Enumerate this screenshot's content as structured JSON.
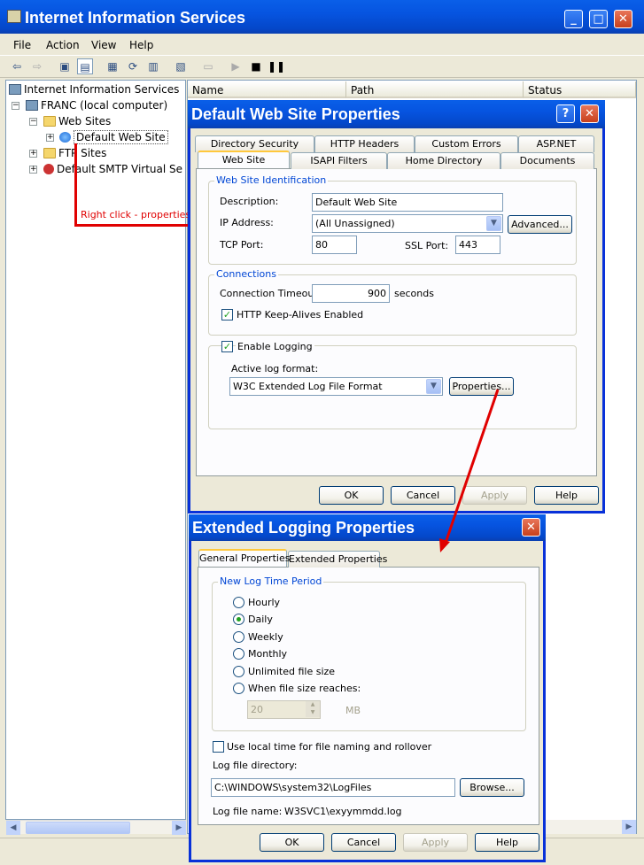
{
  "main": {
    "title": "Internet Information Services",
    "menu": [
      "File",
      "Action",
      "View",
      "Help"
    ],
    "tree": {
      "root": "Internet Information Services",
      "computer": "FRANC (local computer)",
      "web_sites": "Web Sites",
      "default_web_site": "Default Web Site",
      "ftp_sites": "FTP Sites",
      "smtp": "Default SMTP Virtual Se"
    },
    "columns": [
      "Name",
      "Path",
      "Status"
    ]
  },
  "annotation": "Right click - properties",
  "dialog1": {
    "title": "Default Web Site Properties",
    "tabs_back": [
      "Directory Security",
      "HTTP Headers",
      "Custom Errors",
      "ASP.NET"
    ],
    "tabs_front": [
      "Web Site",
      "ISAPI Filters",
      "Home Directory",
      "Documents"
    ],
    "identification": {
      "legend": "Web Site Identification",
      "description_label": "Description:",
      "description_value": "Default Web Site",
      "ip_label": "IP Address:",
      "ip_value": "(All Unassigned)",
      "advanced_button": "Advanced...",
      "tcp_label": "TCP Port:",
      "tcp_value": "80",
      "ssl_label": "SSL Port:",
      "ssl_value": "443"
    },
    "connections": {
      "legend": "Connections",
      "timeout_label": "Connection Timeout:",
      "timeout_value": "900",
      "timeout_unit": "seconds",
      "keepalive_label": "HTTP Keep-Alives Enabled"
    },
    "logging": {
      "enable_label": "Enable Logging",
      "format_label": "Active log format:",
      "format_value": "W3C Extended Log File Format",
      "properties_button": "Properties..."
    },
    "buttons": {
      "ok": "OK",
      "cancel": "Cancel",
      "apply": "Apply",
      "help": "Help"
    }
  },
  "dialog2": {
    "title": "Extended Logging Properties",
    "tabs": [
      "General Properties",
      "Extended Properties"
    ],
    "period": {
      "legend": "New Log Time Period",
      "options": [
        "Hourly",
        "Daily",
        "Weekly",
        "Monthly",
        "Unlimited file size",
        "When file size reaches:"
      ],
      "size_value": "20",
      "size_unit": "MB"
    },
    "local_time_label": "Use local time for file naming and rollover",
    "dir_label": "Log file directory:",
    "dir_value": "C:\\WINDOWS\\system32\\LogFiles",
    "browse_button": "Browse...",
    "filename_label": "Log file name:",
    "filename_value": "W3SVC1\\exyymmdd.log",
    "buttons": {
      "ok": "OK",
      "cancel": "Cancel",
      "apply": "Apply",
      "help": "Help"
    }
  },
  "colors": {
    "titlebar": "#0654e0",
    "annotation": "#e00000",
    "dialog_bg": "#ece9d8"
  }
}
